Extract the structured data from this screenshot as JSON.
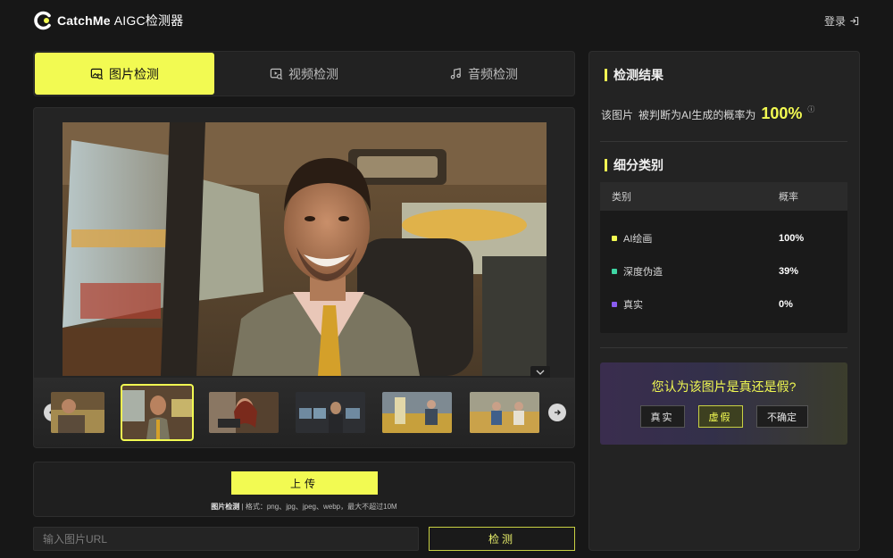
{
  "header": {
    "brand": "CatchMe",
    "product": "AIGC检测器",
    "login": "登录"
  },
  "tabs": [
    {
      "label": "图片检测",
      "icon": "image-search-icon",
      "active": true
    },
    {
      "label": "视频检测",
      "icon": "video-search-icon",
      "active": false
    },
    {
      "label": "音频检测",
      "icon": "music-note-icon",
      "active": false
    }
  ],
  "upload": {
    "button": "上传",
    "hint_strong": "图片检测",
    "hint_sep": "|",
    "hint_formats": "格式：png、jpg、jpeg、webp，最大不超过10M"
  },
  "url_input": {
    "value": "",
    "placeholder": "输入图片URL"
  },
  "detect_button": "检测",
  "result": {
    "title": "检测结果",
    "prefix": "该图片",
    "text": "被判断为AI生成的概率为",
    "probability": "100%",
    "info": "ⓘ"
  },
  "breakdown": {
    "title": "细分类别",
    "columns": [
      "类别",
      "概率"
    ],
    "rows": [
      {
        "category": "AI绘画",
        "probability": "100%",
        "color": "#f2fa52"
      },
      {
        "category": "深度伪造",
        "probability": "39%",
        "color": "#3fd6a4"
      },
      {
        "category": "真实",
        "probability": "0%",
        "color": "#8a5cf0"
      }
    ]
  },
  "vote": {
    "question": "您认为该图片是真还是假?",
    "options": [
      "真实",
      "虚假",
      "不确定"
    ],
    "selected": "虚假"
  },
  "colors": {
    "accent": "#f2fa52",
    "background": "#171717",
    "panel": "#232323"
  },
  "gallery": {
    "selected_index": 1,
    "count": 6
  }
}
